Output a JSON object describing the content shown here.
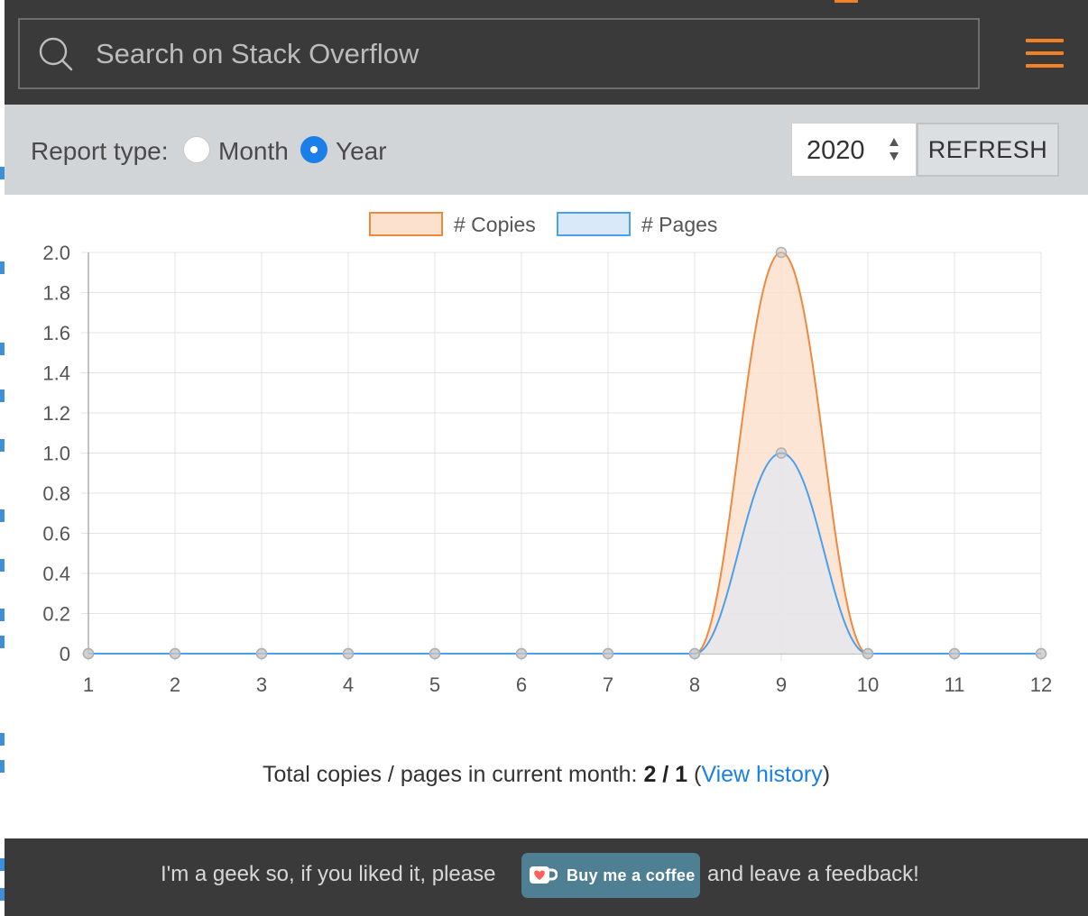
{
  "search": {
    "placeholder": "Search on Stack Overflow"
  },
  "controls": {
    "report_type_label": "Report type:",
    "options": [
      {
        "label": "Month",
        "selected": false
      },
      {
        "label": "Year",
        "selected": true
      }
    ],
    "year_value": "2020",
    "refresh_label": "REFRESH"
  },
  "chart_data": {
    "type": "area",
    "x": [
      1,
      2,
      3,
      4,
      5,
      6,
      7,
      8,
      9,
      10,
      11,
      12
    ],
    "series": [
      {
        "name": "# Copies",
        "values": [
          0,
          0,
          0,
          0,
          0,
          0,
          0,
          0,
          2,
          0,
          0,
          0
        ],
        "color": "#f0883e",
        "fill": "#fde1cf"
      },
      {
        "name": "# Pages",
        "values": [
          0,
          0,
          0,
          0,
          0,
          0,
          0,
          0,
          1,
          0,
          0,
          0
        ],
        "color": "#4aa0ec",
        "fill": "#d9e9f9"
      }
    ],
    "ylim": [
      0,
      2
    ],
    "yticks": [
      "2.0",
      "1.8",
      "1.6",
      "1.4",
      "1.2",
      "1.0",
      "0.8",
      "0.6",
      "0.4",
      "0.2",
      "0"
    ],
    "xticks": [
      "1",
      "2",
      "3",
      "4",
      "5",
      "6",
      "7",
      "8",
      "9",
      "10",
      "11",
      "12"
    ],
    "grid": true,
    "legend": "top-center"
  },
  "totals": {
    "prefix": "Total copies / pages in current month:",
    "value": "2 / 1",
    "link_label": "View history"
  },
  "footer": {
    "text_before": "I'm a geek so, if you liked it, please",
    "button_label": "Buy me a coffee",
    "text_after": "and leave a feedback!"
  },
  "colors": {
    "accent": "#f48024",
    "header_bg": "#3a3a3a",
    "radio_selected": "#1a7fe6",
    "link": "#1a7fe6",
    "coffee_button": "#4f7f93"
  }
}
